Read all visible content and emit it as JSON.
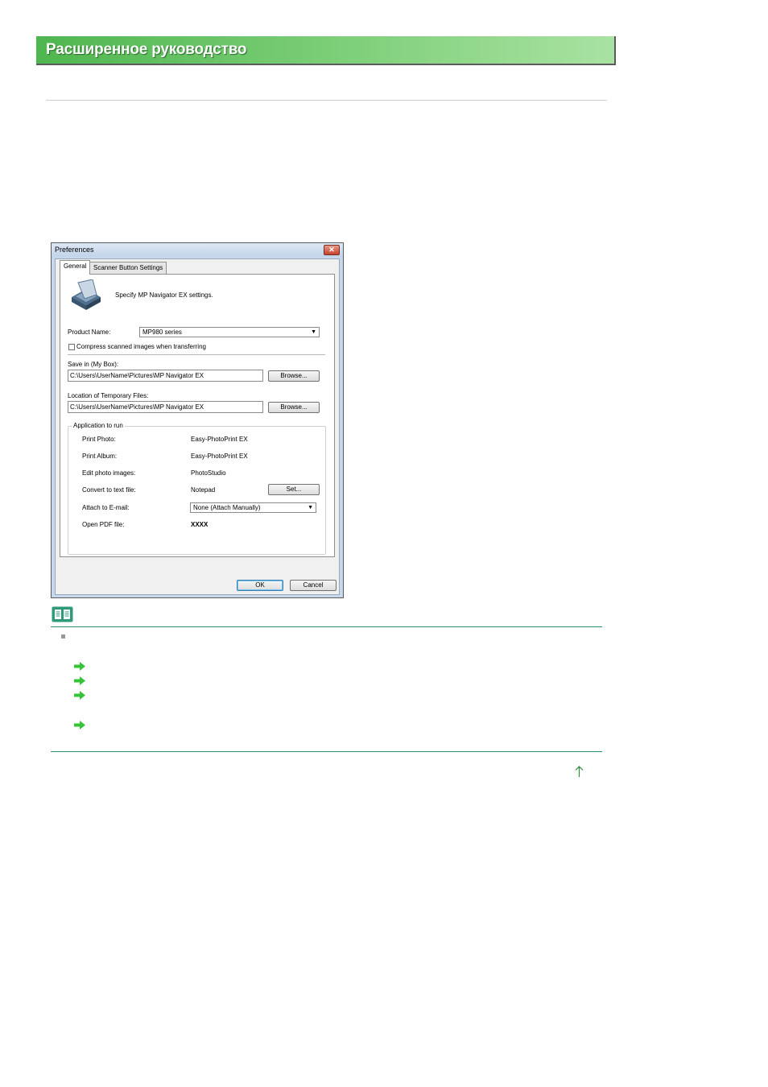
{
  "header": {
    "title": "Расширенное руководство"
  },
  "dialog": {
    "title": "Preferences",
    "close_glyph": "✕",
    "tabs": [
      {
        "label": "General",
        "active": true
      },
      {
        "label": "Scanner Button Settings",
        "active": false
      }
    ],
    "description": "Specify MP Navigator EX settings.",
    "product_name": {
      "label": "Product Name:",
      "value": "MP980 series"
    },
    "compress": {
      "label": "Compress scanned images when transferring",
      "checked": false
    },
    "save_in": {
      "label": "Save in (My Box):",
      "value": "C:\\Users\\UserName\\Pictures\\MP Navigator EX",
      "button": "Browse..."
    },
    "temp_files": {
      "label": "Location of Temporary Files:",
      "value": "C:\\Users\\UserName\\Pictures\\MP Navigator EX",
      "button": "Browse..."
    },
    "app_group": {
      "label": "Application to run",
      "rows": [
        {
          "label": "Print Photo:",
          "value": "Easy-PhotoPrint EX"
        },
        {
          "label": "Print Album:",
          "value": "Easy-PhotoPrint EX"
        },
        {
          "label": "Edit photo images:",
          "value": "PhotoStudio"
        },
        {
          "label": "Convert to text file:",
          "value": "Notepad",
          "button": "Set..."
        },
        {
          "label": "Attach to E-mail:",
          "value": "None (Attach Manually)"
        },
        {
          "label": "Open PDF file:",
          "value": "XXXX"
        }
      ]
    },
    "ok_label": "OK",
    "cancel_label": "Cancel"
  },
  "note": {
    "icon": "book-icon",
    "links": [
      {
        "icon": "green-arrow-icon"
      },
      {
        "icon": "green-arrow-icon"
      },
      {
        "icon": "green-arrow-icon"
      },
      {
        "icon": "green-arrow-icon"
      }
    ]
  },
  "back_to_top_icon": "up-arrow-icon",
  "colors": {
    "banner": "#4fb64f",
    "rule": "#2e8b6e",
    "arrow": "#36c436"
  }
}
